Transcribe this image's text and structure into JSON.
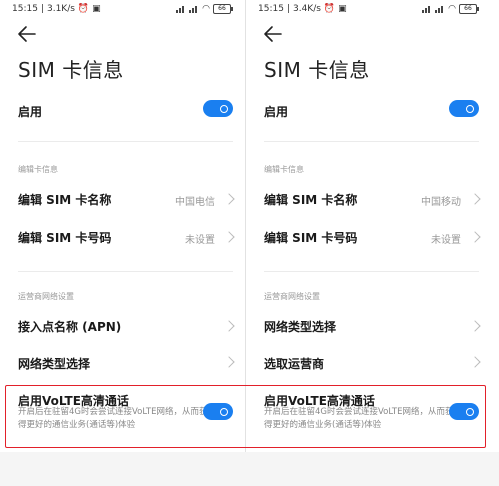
{
  "colors": {
    "accent": "#1a7ff0",
    "highlight": "#e2202a"
  },
  "panels": [
    {
      "status": {
        "time": "15:15",
        "speed": "3.1K/s",
        "battery": "66"
      },
      "title": "SIM 卡信息",
      "enable": {
        "label": "启用",
        "on": true
      },
      "card_section": {
        "header": "编辑卡信息",
        "items": [
          {
            "label": "编辑 SIM 卡名称",
            "value": "中国电信"
          },
          {
            "label": "编辑 SIM 卡号码",
            "value": "未设置"
          }
        ]
      },
      "carrier_section": {
        "header": "运营商网络设置",
        "items": [
          {
            "label": "接入点名称 (APN)"
          },
          {
            "label": "网络类型选择"
          }
        ]
      },
      "volte": {
        "title": "启用VoLTE高清通话",
        "desc": "开启后在驻留4G时会尝试连接VoLTE网络，从而获得更好的通信业务(通话等)体验",
        "on": true
      }
    },
    {
      "status": {
        "time": "15:15",
        "speed": "3.4K/s",
        "battery": "66"
      },
      "title": "SIM 卡信息",
      "enable": {
        "label": "启用",
        "on": true
      },
      "card_section": {
        "header": "编辑卡信息",
        "items": [
          {
            "label": "编辑 SIM 卡名称",
            "value": "中国移动"
          },
          {
            "label": "编辑 SIM 卡号码",
            "value": "未设置"
          }
        ]
      },
      "carrier_section": {
        "header": "运营商网络设置",
        "items": [
          {
            "label": "网络类型选择"
          },
          {
            "label": "选取运营商"
          }
        ]
      },
      "volte": {
        "title": "启用VoLTE高清通话",
        "desc": "开启后在驻留4G时会尝试连接VoLTE网络，从而获得更好的通信业务(通话等)体验",
        "on": true
      }
    }
  ]
}
